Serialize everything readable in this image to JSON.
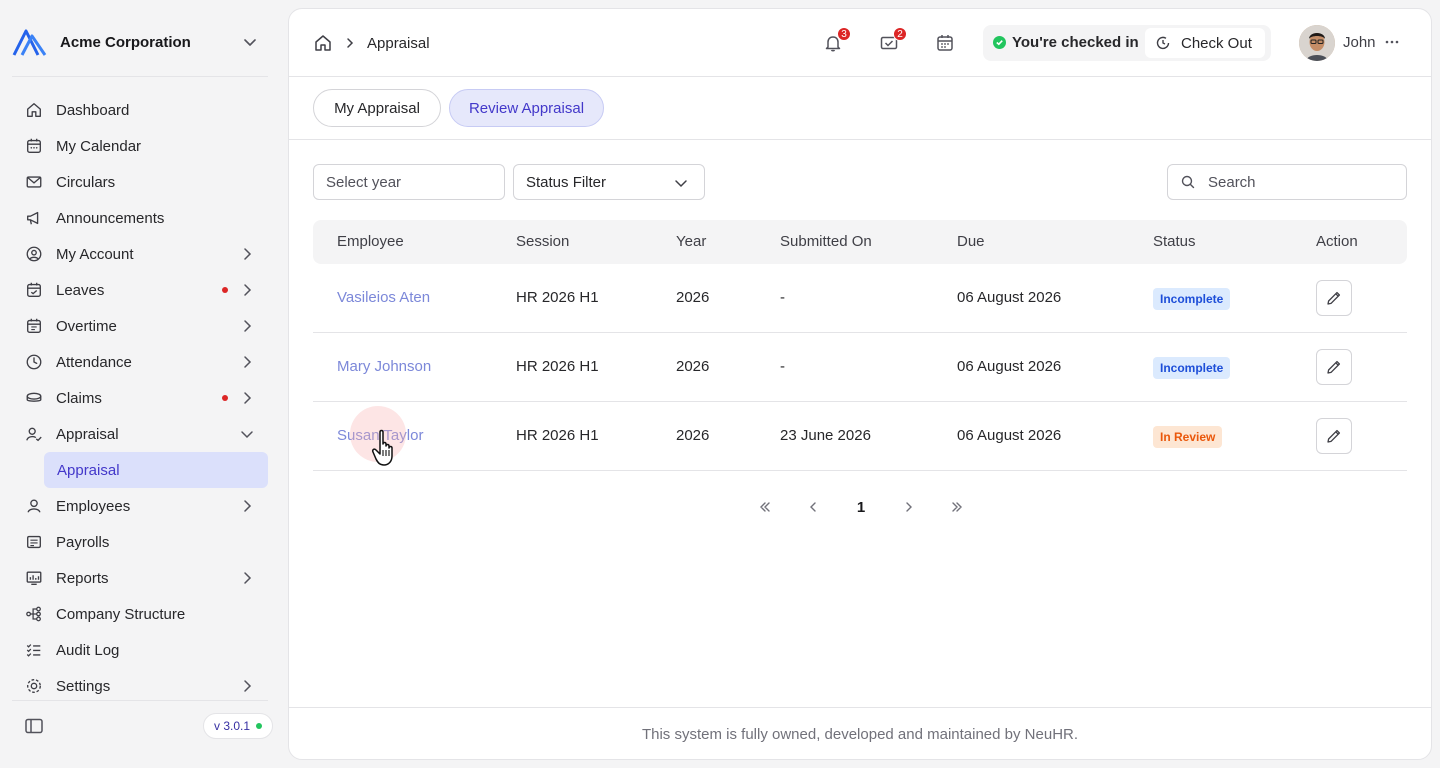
{
  "org": {
    "name": "Acme Corporation"
  },
  "sidebar": {
    "items": [
      {
        "label": "Dashboard",
        "icon": "home-icon"
      },
      {
        "label": "My Calendar",
        "icon": "calendar-icon"
      },
      {
        "label": "Circulars",
        "icon": "mail-icon"
      },
      {
        "label": "Announcements",
        "icon": "megaphone-icon"
      },
      {
        "label": "My Account",
        "icon": "user-circle-icon",
        "expandable": true
      },
      {
        "label": "Leaves",
        "icon": "calendar-check-icon",
        "expandable": true,
        "dot": true
      },
      {
        "label": "Overtime",
        "icon": "calendar-clock-icon",
        "expandable": true
      },
      {
        "label": "Attendance",
        "icon": "clock-icon",
        "expandable": true
      },
      {
        "label": "Claims",
        "icon": "coins-icon",
        "expandable": true,
        "dot": true
      },
      {
        "label": "Appraisal",
        "icon": "user-check-icon",
        "expanded": true
      },
      {
        "label": "Employees",
        "icon": "user-icon",
        "expandable": true
      },
      {
        "label": "Payrolls",
        "icon": "receipt-icon"
      },
      {
        "label": "Reports",
        "icon": "chart-icon",
        "expandable": true
      },
      {
        "label": "Company Structure",
        "icon": "hierarchy-icon"
      },
      {
        "label": "Audit Log",
        "icon": "checklist-icon"
      },
      {
        "label": "Settings",
        "icon": "settings-icon",
        "expandable": true
      }
    ],
    "sub_item": "Appraisal",
    "version": "v 3.0.1"
  },
  "topbar": {
    "breadcrumb": "Appraisal",
    "notifications_count": "3",
    "messages_count": "2",
    "checked_in_text": "You're checked in",
    "checkout_label": "Check Out",
    "user_name": "John"
  },
  "tabs": [
    {
      "label": "My Appraisal",
      "active": false
    },
    {
      "label": "Review Appraisal",
      "active": true
    }
  ],
  "filters": {
    "year_placeholder": "Select year",
    "status_label": "Status Filter",
    "search_placeholder": "Search"
  },
  "table": {
    "headers": [
      "Employee",
      "Session",
      "Year",
      "Submitted On",
      "Due",
      "Status",
      "Action"
    ],
    "rows": [
      {
        "employee": "Vasileios Aten",
        "session": "HR 2026 H1",
        "year": "2026",
        "submitted": "-",
        "due": "06 August 2026",
        "status": "Incomplete",
        "status_type": "incomplete"
      },
      {
        "employee": "Mary Johnson",
        "session": "HR 2026 H1",
        "year": "2026",
        "submitted": "-",
        "due": "06 August 2026",
        "status": "Incomplete",
        "status_type": "incomplete"
      },
      {
        "employee": "Susan Taylor",
        "session": "HR 2026 H1",
        "year": "2026",
        "submitted": "23 June 2026",
        "due": "06 August 2026",
        "status": "In Review",
        "status_type": "review"
      }
    ]
  },
  "pagination": {
    "current": "1"
  },
  "footer": {
    "text": "This system is fully owned, developed and maintained by NeuHR."
  },
  "colors": {
    "accent": "#4338ca",
    "link": "#7c88d9",
    "danger": "#dc2626",
    "success": "#22c55e"
  }
}
